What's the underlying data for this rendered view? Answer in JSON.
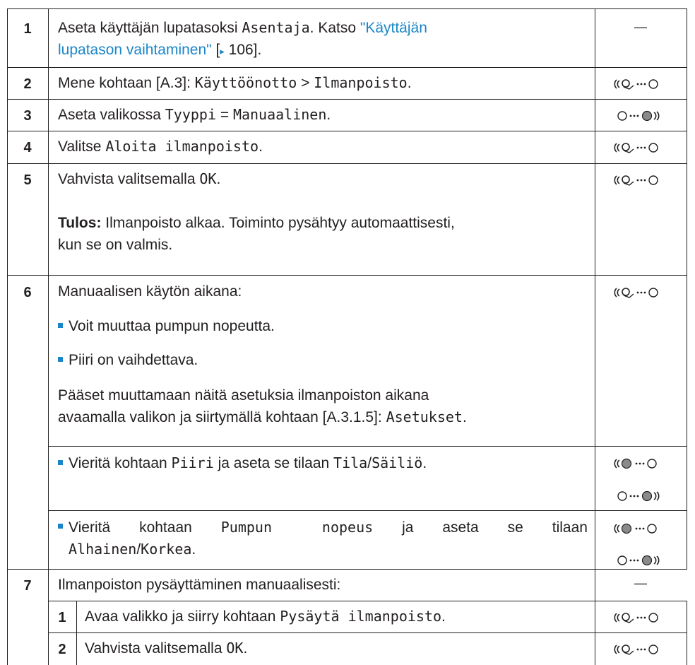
{
  "steps": {
    "s1": {
      "num": "1",
      "t_a": "Aseta käyttäjän lupatasoksi",
      "t_b": "Asentaja",
      "t_c": ". Katso",
      "link_a": "\"Käyttäjän",
      "link_b": "lupatason vaihtaminen\"",
      "ref_a": " [",
      "ref_b": "▸",
      "ref_c": " 106].",
      "action": "—"
    },
    "s2": {
      "num": "2",
      "t_a": "Mene kohtaan [A.3]: ",
      "t_b": "Käyttöönotto",
      "t_c": " > ",
      "t_d": "Ilmanpoisto",
      "t_e": "."
    },
    "s3": {
      "num": "3",
      "t_a": "Aseta valikossa ",
      "t_b": "Tyyppi",
      "t_c": " = ",
      "t_d": "Manuaalinen",
      "t_e": "."
    },
    "s4": {
      "num": "4",
      "t_a": "Valitse ",
      "t_b": "Aloita ilmanpoisto",
      "t_c": "."
    },
    "s5": {
      "num": "5",
      "t_a": "Vahvista valitsemalla ",
      "t_b": "OK",
      "t_c": ".",
      "result_label": "Tulos:",
      "result_a": " Ilmanpoisto alkaa. Toiminto pysähtyy automaattisesti,",
      "result_b": "kun se on valmis."
    },
    "s6": {
      "num": "6",
      "intro": "Manuaalisen käytön aikana:",
      "bullet_1": "Voit muuttaa pumpun nopeutta.",
      "bullet_2": "Piiri on vaihdettava.",
      "para_a": "Pääset muuttamaan näitä asetuksia ilmanpoiston aikana",
      "para_b": "avaamalla valikon ja siirtymällä kohtaan [A.3.1.5]: ",
      "para_c": "Asetukset",
      "para_d": ".",
      "sub1_a": "Vieritä kohtaan ",
      "sub1_b": "Piiri",
      "sub1_c": " ja aseta se tilaan ",
      "sub1_d": "Tila",
      "sub1_e": "/",
      "sub1_f": "Säiliö",
      "sub1_g": ".",
      "sub2_a": "Vieritä",
      "sub2_b": "kohtaan",
      "sub2_c": "Pumpun",
      "sub2_d": "nopeus",
      "sub2_e": "ja",
      "sub2_f": "aseta",
      "sub2_g": "se",
      "sub2_h": "tilaan",
      "sub2_i": "Alhainen",
      "sub2_j": "/",
      "sub2_k": "Korkea",
      "sub2_l": "."
    },
    "s7": {
      "num": "7",
      "t": "Ilmanpoiston pysäyttäminen manuaalisesti:",
      "action": "—",
      "sub1_num": "1",
      "sub1_a": "Avaa valikko ja siirry kohtaan ",
      "sub1_b": "Pysäytä ilmanpoisto",
      "sub1_c": ".",
      "sub2_num": "2",
      "sub2_a": "Vahvista valitsemalla ",
      "sub2_b": "OK",
      "sub2_c": "."
    }
  },
  "icons": {
    "press_dial": "push-dial-icon",
    "left_dial": "left-dial-icon",
    "right_dial": "right-dial-icon"
  },
  "colors": {
    "accent": "#1a86c8",
    "text": "#231f20"
  }
}
